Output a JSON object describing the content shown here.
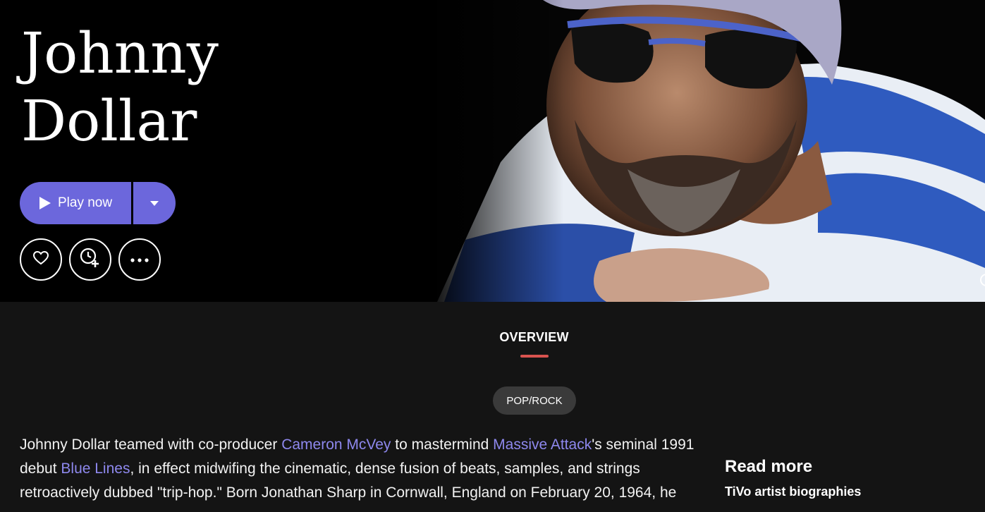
{
  "artist": {
    "name": "Johnny Dollar"
  },
  "actions": {
    "play_label": "Play now"
  },
  "overview": {
    "tab_label": "OVERVIEW",
    "genre": "POP/ROCK"
  },
  "bio": {
    "t1": "Johnny Dollar teamed with co-producer ",
    "link1": "Cameron McVey",
    "t2": " to mastermind ",
    "link2": "Massive Attack",
    "t3": "'s seminal 1991 debut ",
    "link3": "Blue Lines",
    "t4": ", in effect midwifing the cinematic, dense fusion of beats, samples, and strings retroactively dubbed \"trip-hop.\" Born Jonathan Sharp in Cornwall, England on February 20, 1964, he"
  },
  "read_more": {
    "title": "Read more",
    "source": "TiVo artist biographies"
  },
  "colors": {
    "accent": "#6c67dc",
    "link": "#8e88ee",
    "tab_underline": "#d9534f",
    "background": "#141414"
  }
}
